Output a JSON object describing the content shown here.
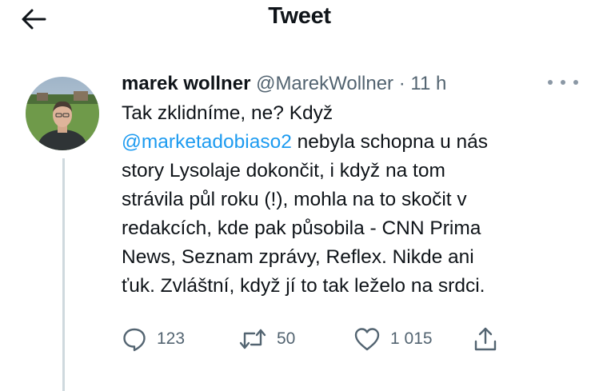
{
  "header": {
    "title": "Tweet"
  },
  "tweet": {
    "author_name": "marek wollner",
    "author_handle": "@MarekWollner",
    "separator": "·",
    "time": "11 h",
    "text_lines": [
      [
        "Tak zklidníme, ne? Když"
      ],
      [
        "@marketadobiaso2",
        " nebyla schopna u nás"
      ],
      [
        "story Lysolaje dokončit, i když na tom"
      ],
      [
        "strávila půl roku (!), mohla na to skočit v"
      ],
      [
        "redakcích, kde pak působila - CNN Prima"
      ],
      [
        "News, Seznam zprávy, Reflex. Nikde ani"
      ],
      [
        "ťuk. Zvláštní, když jí to tak leželo na srdci."
      ]
    ],
    "mention": "@marketadobiaso2"
  },
  "actions": {
    "replies": "123",
    "retweets": "50",
    "likes": "1 015"
  },
  "icons": {
    "back": "arrow-left-icon",
    "more": "more-dots-icon",
    "reply": "reply-icon",
    "retweet": "retweet-icon",
    "like": "heart-icon",
    "share": "share-icon"
  },
  "colors": {
    "text": "#0f1419",
    "secondary": "#536471",
    "link": "#1d9bf0",
    "thread_line": "#cfd9de"
  }
}
